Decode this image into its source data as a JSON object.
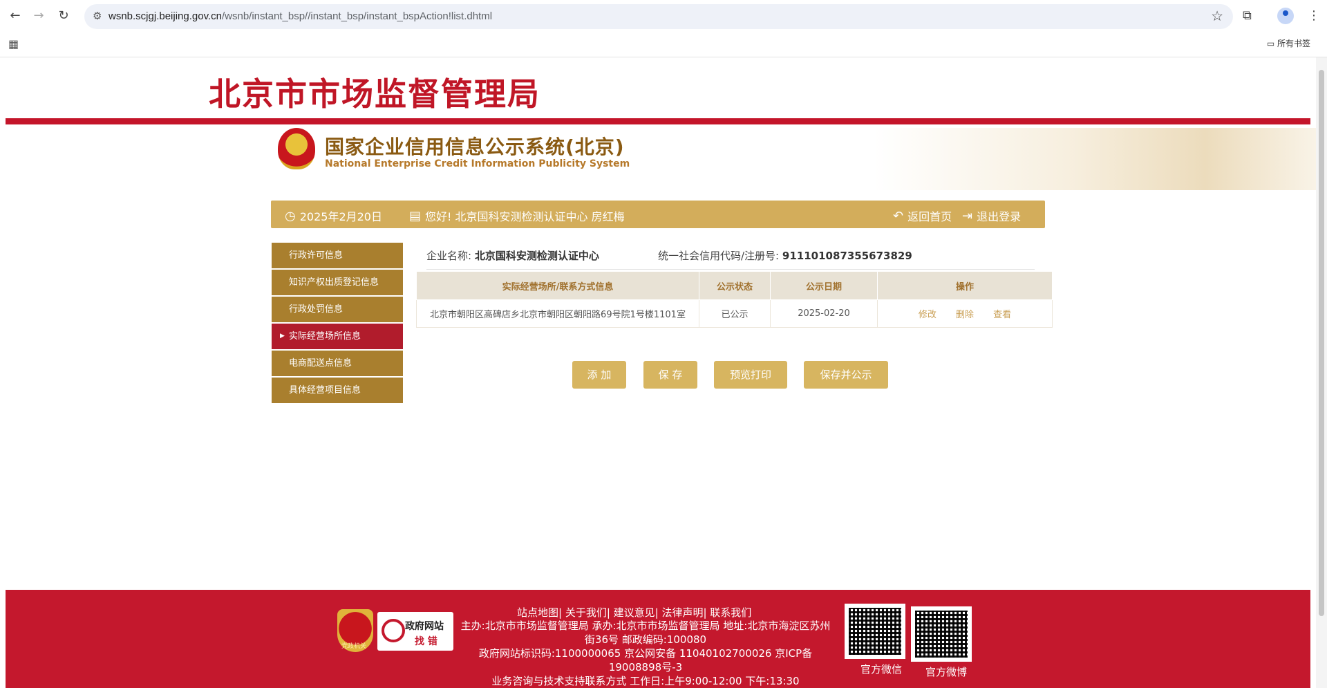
{
  "browser": {
    "url_host": "wsnb.scjgj.beijing.gov.cn",
    "url_path": "/wsnb/instant_bsp//instant_bsp/instant_bspAction!list.dhtml",
    "bookmarks_label": "所有书签"
  },
  "header": {
    "agency_title": "北京市市场监督管理局",
    "system_title": "国家企业信用信息公示系统(北京)",
    "system_subtitle": "National Enterprise Credit Information Publicity System"
  },
  "info_bar": {
    "date": "2025年2月20日",
    "greeting": "您好!  北京国科安测检测认证中心  房红梅",
    "home_label": "返回首页",
    "logout_label": "退出登录"
  },
  "sidebar": {
    "items": [
      {
        "label": "行政许可信息"
      },
      {
        "label": "知识产权出质登记信息"
      },
      {
        "label": "行政处罚信息"
      },
      {
        "label": "实际经营场所信息"
      },
      {
        "label": "电商配送点信息"
      },
      {
        "label": "具体经营项目信息"
      }
    ],
    "active_index": 3
  },
  "company": {
    "name_label": "企业名称:",
    "name": "北京国科安测检测认证中心",
    "code_label": "统一社会信用代码/注册号:",
    "code": "911101087355673829"
  },
  "table": {
    "headers": [
      "实际经营场所/联系方式信息",
      "公示状态",
      "公示日期",
      "操作"
    ],
    "rows": [
      {
        "address": "北京市朝阳区高碑店乡北京市朝阳区朝阳路69号院1号楼1101室",
        "status": "已公示",
        "date": "2025-02-20",
        "edit": "修改",
        "delete": "删除",
        "view": "查看"
      }
    ]
  },
  "buttons": {
    "add": "添 加",
    "save": "保 存",
    "preview": "预览打印",
    "save_publish": "保存并公示"
  },
  "footer": {
    "links": "站点地图| 关于我们| 建议意见| 法律声明| 联系我们",
    "line1": "主办:北京市市场监督管理局 承办:北京市市场监督管理局 地址:北京市海淀区苏州街36号 邮政编码:100080",
    "line2": "政府网站标识码:1100000065    京公网安备 11040102700026    京ICP备19008898号-3",
    "line3": "业务咨询与技术支持联系方式   工作日:上午9:00-12:00 下午:13:30",
    "party_label": "党政机关",
    "gov_error_t1": "政府网站",
    "gov_error_t2": "找 错",
    "wechat_label": "官方微信",
    "weibo_label": "官方微博"
  },
  "colors": {
    "brand_red": "#c4152a",
    "gold": "#d3ad5b",
    "sidebar_brown": "#a97f2e"
  }
}
